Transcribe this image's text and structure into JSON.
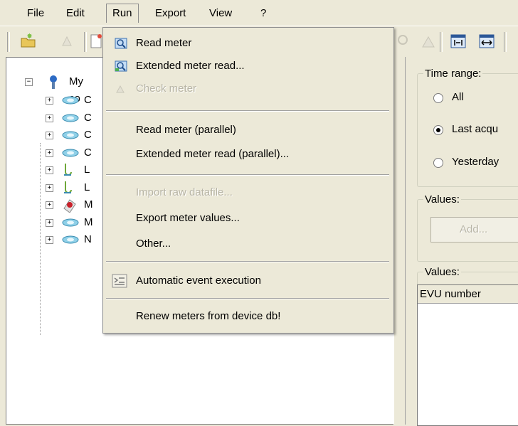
{
  "menubar": {
    "items": [
      {
        "label": "File"
      },
      {
        "label": "Edit"
      },
      {
        "label": "Run"
      },
      {
        "label": "Export"
      },
      {
        "label": "View"
      },
      {
        "label": "?"
      }
    ]
  },
  "run_menu": {
    "items": [
      {
        "label": "Read meter",
        "icon": "read-meter-icon",
        "enabled": true
      },
      {
        "label": "Extended meter read...",
        "icon": "extended-read-icon",
        "enabled": true
      },
      {
        "label": "Check meter",
        "icon": "check-meter-icon",
        "enabled": false
      },
      {
        "label": "Read meter (parallel)",
        "enabled": true
      },
      {
        "label": "Extended meter read (parallel)...",
        "enabled": true
      },
      {
        "label": "Import raw datafile...",
        "enabled": false
      },
      {
        "label": "Export meter values...",
        "enabled": true
      },
      {
        "label": "Other...",
        "enabled": true
      },
      {
        "label": "Automatic event execution",
        "icon": "automatic-event-icon",
        "enabled": true
      },
      {
        "label": "Renew meters from device db!",
        "enabled": true
      }
    ]
  },
  "tree": {
    "root_label": "My co",
    "children": [
      {
        "label": "C",
        "icon": "meter-icon"
      },
      {
        "label": "C",
        "icon": "meter-icon"
      },
      {
        "label": "C",
        "icon": "meter-icon"
      },
      {
        "label": "C",
        "icon": "meter-icon"
      },
      {
        "label": "L",
        "icon": "l-device-icon"
      },
      {
        "label": "L",
        "icon": "l-device-icon"
      },
      {
        "label": "M",
        "icon": "m-device-red-icon"
      },
      {
        "label": "M",
        "icon": "meter-icon"
      },
      {
        "label": "N",
        "icon": "meter-icon"
      }
    ]
  },
  "right": {
    "time_range_title": "Time range:",
    "radio_all": "All",
    "radio_last": "Last acqu",
    "radio_yesterday": "Yesterday",
    "selected_time_range": "Last acqu",
    "values_group_title": "Values:",
    "add_button": "Add...",
    "values_grid_title": "Values:",
    "grid_column_header": "EVU number"
  }
}
